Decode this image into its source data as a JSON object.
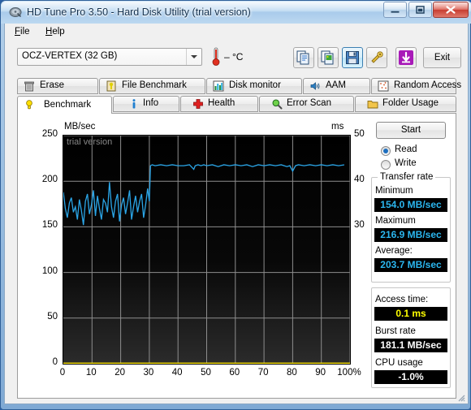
{
  "window": {
    "title": "HD Tune Pro 3.50 - Hard Disk Utility (trial version)",
    "app_icon": "hard-disk-icon",
    "minimize_label": "—",
    "maximize_label": "□",
    "close_label": "✕"
  },
  "menu": {
    "items": [
      {
        "label": "File",
        "accel": "F"
      },
      {
        "label": "Help",
        "accel": "H"
      }
    ]
  },
  "toolbar": {
    "drive": {
      "selected": "OCZ-VERTEX (32 GB)",
      "options": [
        "OCZ-VERTEX (32 GB)"
      ]
    },
    "temperature": "– °C",
    "thermometer_icon": "thermometer-icon",
    "buttons": [
      {
        "name": "copy-text-button",
        "icon": "copy-text-icon",
        "selected": false
      },
      {
        "name": "copy-image-button",
        "icon": "copy-image-icon",
        "selected": false
      },
      {
        "name": "save-button",
        "icon": "floppy-save-icon",
        "selected": true
      },
      {
        "name": "options-button",
        "icon": "tools-gear-icon",
        "selected": false
      },
      {
        "name": "download-button",
        "icon": "download-arrow-icon",
        "selected": false
      }
    ],
    "exit_label": "Exit"
  },
  "tabs": {
    "row1": [
      {
        "label": "Erase",
        "icon": "trash-can-icon",
        "active": false
      },
      {
        "label": "File Benchmark",
        "icon": "file-benchmark-icon",
        "active": false
      },
      {
        "label": "Disk monitor",
        "icon": "bar-chart-icon",
        "active": false
      },
      {
        "label": "AAM",
        "icon": "speaker-icon",
        "active": false
      },
      {
        "label": "Random Access",
        "icon": "random-access-icon",
        "active": false
      }
    ],
    "row2": [
      {
        "label": "Benchmark",
        "icon": "lightbulb-icon",
        "active": true
      },
      {
        "label": "Info",
        "icon": "info-icon",
        "active": false
      },
      {
        "label": "Health",
        "icon": "red-cross-icon",
        "active": false
      },
      {
        "label": "Error Scan",
        "icon": "magnifier-icon",
        "active": false
      },
      {
        "label": "Folder Usage",
        "icon": "folder-icon",
        "active": false
      }
    ]
  },
  "chart_data": {
    "type": "line",
    "title": "",
    "watermark": "trial version",
    "xlabel": "",
    "ylabel": "MB/sec",
    "y2label": "ms",
    "xlim": [
      0,
      100
    ],
    "ylim": [
      0,
      250
    ],
    "y2lim": [
      0,
      50
    ],
    "grid": true,
    "x_ticks": [
      0,
      10,
      20,
      30,
      40,
      50,
      60,
      70,
      80,
      90,
      100
    ],
    "x_tick_labels": [
      "0",
      "10",
      "20",
      "30",
      "40",
      "50",
      "60",
      "70",
      "80",
      "90",
      "100%"
    ],
    "y_ticks": [
      0,
      50,
      100,
      150,
      200,
      250
    ],
    "y_tick_labels": [
      "0",
      "50",
      "100",
      "150",
      "200",
      "250"
    ],
    "y2_ticks": [
      30,
      40,
      50
    ],
    "y2_tick_labels": [
      "30",
      "40",
      "50"
    ],
    "series": [
      {
        "name": "transfer rate",
        "color": "#2ba6e8",
        "axis": "left",
        "x": [
          0,
          0.7,
          1.4,
          2.1,
          2.8,
          3.5,
          4.2,
          4.9,
          5.6,
          6.3,
          7.0,
          7.7,
          8.4,
          9.1,
          9.8,
          10.5,
          11.2,
          11.9,
          12.6,
          13.3,
          14.0,
          14.7,
          15.4,
          16.1,
          16.8,
          17.5,
          18.2,
          18.9,
          19.6,
          20.3,
          21.0,
          21.7,
          22.4,
          23.1,
          23.8,
          24.5,
          25.2,
          25.9,
          26.6,
          27.3,
          28.0,
          28.7,
          29.4,
          30.0,
          30.4,
          31.0,
          32,
          34,
          36,
          38,
          40,
          42,
          44,
          45.5,
          46,
          47,
          48,
          49,
          50,
          52,
          54,
          56,
          58,
          60,
          62,
          64,
          66,
          68,
          70,
          72,
          74,
          76,
          78,
          79,
          80,
          81,
          82,
          84,
          86,
          88,
          90,
          92,
          94,
          96,
          98,
          100
        ],
        "y": [
          188,
          170,
          160,
          176,
          182,
          166,
          172,
          158,
          180,
          168,
          152,
          178,
          186,
          164,
          174,
          190,
          162,
          184,
          170,
          158,
          180,
          176,
          166,
          199,
          172,
          160,
          178,
          186,
          156,
          174,
          182,
          164,
          176,
          190,
          158,
          172,
          184,
          166,
          178,
          186,
          160,
          174,
          192,
          178,
          217,
          218,
          217,
          218,
          217,
          218,
          217,
          217,
          218,
          213,
          217,
          218,
          217,
          218,
          217,
          218,
          216,
          218,
          217,
          218,
          217,
          218,
          216,
          218,
          217,
          218,
          217,
          218,
          216,
          217,
          211,
          217,
          218,
          217,
          218,
          217,
          218,
          217,
          218,
          217,
          218
        ]
      },
      {
        "name": "access time",
        "color": "#ffe800",
        "axis": "right",
        "x": [
          0,
          10,
          20,
          30,
          40,
          50,
          60,
          70,
          80,
          90,
          100
        ],
        "y": [
          0.1,
          0.1,
          0.1,
          0.1,
          0.1,
          0.1,
          0.1,
          0.1,
          0.1,
          0.1,
          0.1
        ]
      }
    ]
  },
  "results": {
    "start_label": "Start",
    "mode": {
      "read_label": "Read",
      "write_label": "Write",
      "selected": "Read"
    },
    "transfer_rate": {
      "group_label": "Transfer rate",
      "minimum_label": "Minimum",
      "minimum_value": "154.0 MB/sec",
      "maximum_label": "Maximum",
      "maximum_value": "216.9 MB/sec",
      "average_label": "Average:",
      "average_value": "203.7 MB/sec"
    },
    "access_time_label": "Access time:",
    "access_time_value": "0.1 ms",
    "burst_rate_label": "Burst rate",
    "burst_rate_value": "181.1 MB/sec",
    "cpu_usage_label": "CPU usage",
    "cpu_usage_value": "-1.0%"
  },
  "colors": {
    "transfer_line": "#2ba6e8",
    "access_line": "#ffe800",
    "value_cyan": "#2bb6ef",
    "value_yellow": "#ffff00",
    "accent_blue": "#2f6099"
  }
}
